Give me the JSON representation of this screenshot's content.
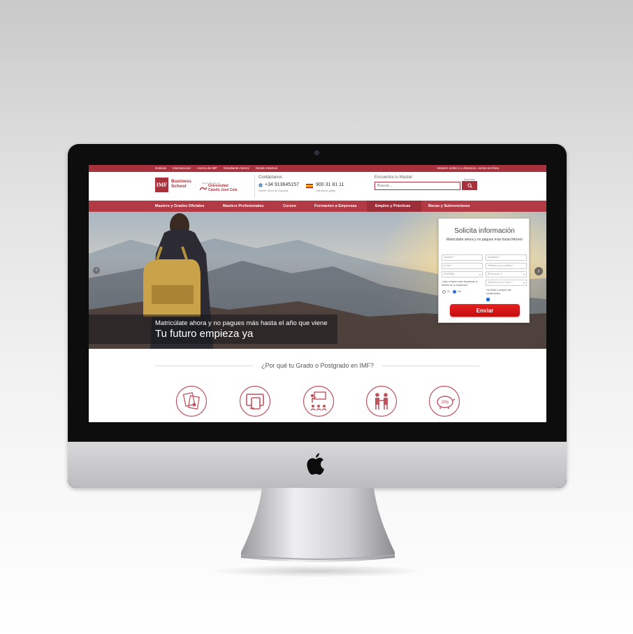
{
  "topbar": {
    "links": [
      "Noticias",
      "Internacional",
      "Acerca de IMF",
      "Estudiante-Alumni",
      "Dónde estamos"
    ],
    "right_text": "Masters online y a distancia, cursos en línea"
  },
  "header": {
    "logo_mark": "IMF",
    "logo_line1": "Business",
    "logo_line2": "School",
    "partner_small": "Centro adscrito a la",
    "partner_line1": "Universidad",
    "partner_line2": "Camilo José Cela",
    "contact_title": "Contáctanos",
    "phone_intl": "+34 913645157",
    "phone_intl_sub": "Desde fuera de España",
    "phone_es": "900 31 81 11",
    "phone_es_sub": "Llámanos gratis",
    "search_title": "Encuentra tu Master:",
    "search_placeholder": "Buscar...",
    "search_advanced": "Avanzada"
  },
  "nav": {
    "items": [
      "Masters y Grados Oficiales",
      "Masters Profesionales",
      "Cursos",
      "Formacion a Empresas",
      "Empleo y Prácticas",
      "Becas y Subvenciones"
    ]
  },
  "hero": {
    "caption_sub": "Matricúlate ahora y no pagues más hasta el año que viene",
    "caption_main": "Tu futuro empieza ya",
    "prev": "‹",
    "next": "›"
  },
  "form": {
    "title": "Solicita información",
    "subtitle": "Matricúlate ahora y no pagues más hasta febrero",
    "fields": {
      "nombre": "Nombre *",
      "apellidos": "Apellidos *",
      "email": "Email *",
      "telefono": "Teléfono (con prefijo) *",
      "pais": "ESPAÑA",
      "provincia": "[Provincia *]",
      "curso": "Selecciona tu curso *"
    },
    "question": "¿Vas a hacer esta formación a través de tu empresa?",
    "option_si": "Sí",
    "option_no": "No",
    "legal": "He leído y acepto las condiciones",
    "submit": "Enviar"
  },
  "why": {
    "title": "¿Por qué tu Grado o Postgrado en IMF?",
    "icon_percent": "0%"
  },
  "colors": {
    "brand": "#a7313c",
    "nav": "#b23a45",
    "button": "#e01818"
  }
}
